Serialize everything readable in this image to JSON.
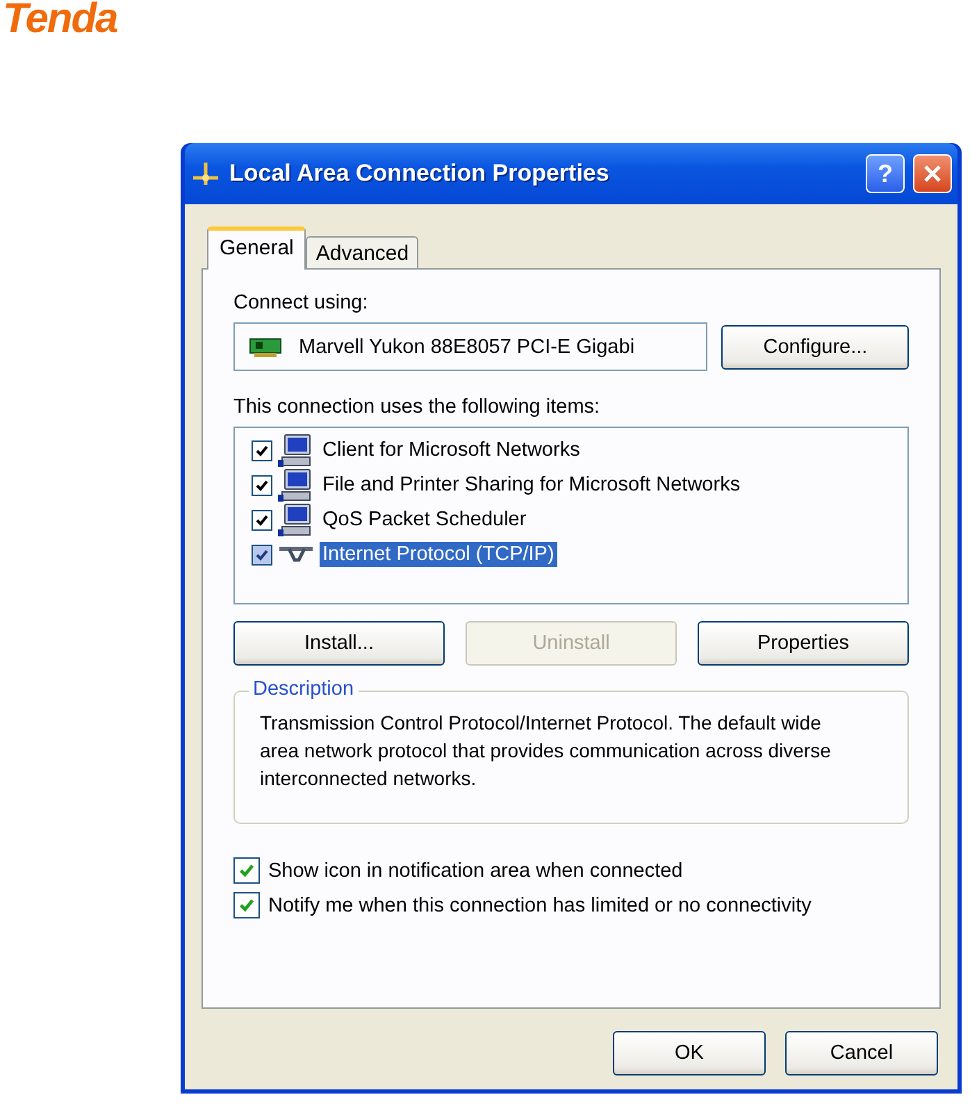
{
  "header": {
    "logo": "Tenda"
  },
  "window": {
    "title": "Local Area Connection Properties",
    "help": "?"
  },
  "tabs": [
    {
      "label": "General",
      "selected": true
    },
    {
      "label": "Advanced",
      "selected": false
    }
  ],
  "connect_using": {
    "label": "Connect using:",
    "adapter": "Marvell Yukon 88E8057 PCI-E Gigabi",
    "configure": "Configure..."
  },
  "items": {
    "label": "This connection uses the following items:",
    "list": [
      {
        "label": "Client for Microsoft Networks",
        "checked": true,
        "selected": false,
        "kind": "computer"
      },
      {
        "label": "File and Printer Sharing for Microsoft Networks",
        "checked": true,
        "selected": false,
        "kind": "computer"
      },
      {
        "label": "QoS Packet Scheduler",
        "checked": true,
        "selected": false,
        "kind": "computer"
      },
      {
        "label": "Internet Protocol (TCP/IP)",
        "checked": true,
        "selected": true,
        "kind": "protocol"
      }
    ]
  },
  "item_buttons": [
    {
      "label": "Install...",
      "disabled": false
    },
    {
      "label": "Uninstall",
      "disabled": true
    },
    {
      "label": "Properties",
      "disabled": false
    }
  ],
  "description": {
    "legend": "Description",
    "text": "Transmission Control Protocol/Internet Protocol. The default wide area network protocol that provides communication across diverse interconnected networks."
  },
  "options": [
    {
      "label": "Show icon in notification area when connected",
      "checked": true
    },
    {
      "label": "Notify me when this connection has limited or no connectivity",
      "checked": true
    }
  ],
  "footer": [
    "OK",
    "Cancel"
  ]
}
